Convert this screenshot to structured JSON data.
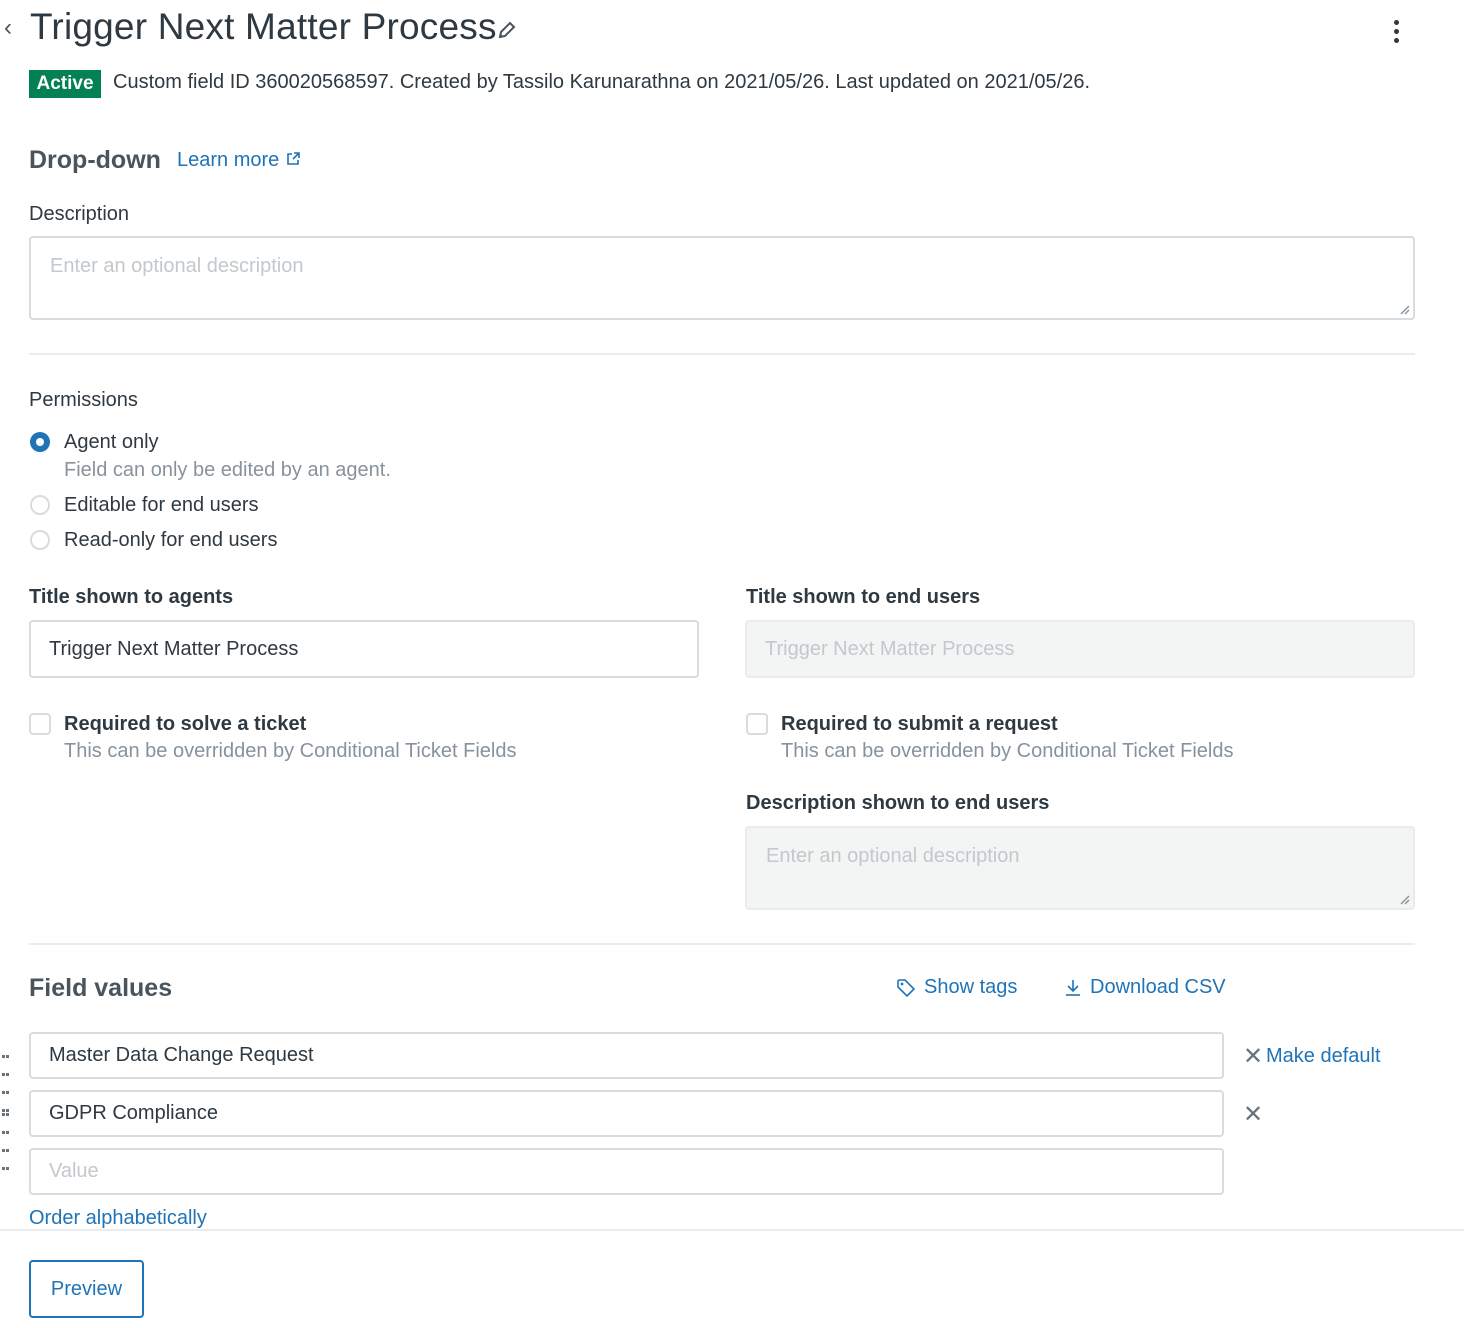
{
  "header": {
    "title": "Trigger Next Matter Process",
    "status_badge": "Active",
    "meta": "Custom field ID 360020568597. Created by Tassilo Karunarathna on 2021/05/26. Last updated on 2021/05/26."
  },
  "field_type": {
    "label": "Drop-down",
    "learn_more": "Learn more"
  },
  "description": {
    "label": "Description",
    "placeholder": "Enter an optional description"
  },
  "permissions": {
    "label": "Permissions",
    "options": [
      {
        "label": "Agent only",
        "hint": "Field can only be edited by an agent.",
        "checked": true
      },
      {
        "label": "Editable for end users",
        "checked": false
      },
      {
        "label": "Read-only for end users",
        "checked": false
      }
    ]
  },
  "agents": {
    "title_label": "Title shown to agents",
    "title_value": "Trigger Next Matter Process",
    "required_label": "Required to solve a ticket",
    "required_hint": "This can be overridden by Conditional Ticket Fields"
  },
  "end_users": {
    "title_label": "Title shown to end users",
    "title_value": "Trigger Next Matter Process",
    "required_label": "Required to submit a request",
    "required_hint": "This can be overridden by Conditional Ticket Fields",
    "description_label": "Description shown to end users",
    "description_placeholder": "Enter an optional description"
  },
  "field_values": {
    "heading": "Field values",
    "show_tags": "Show tags",
    "download_csv": "Download CSV",
    "values": [
      "Master Data Change Request",
      "GDPR Compliance"
    ],
    "new_value_placeholder": "Value",
    "make_default": "Make default",
    "order_alphabetically": "Order alphabetically"
  },
  "footer": {
    "preview": "Preview"
  },
  "colors": {
    "accent": "#1f73b7",
    "active_badge": "#038153"
  }
}
